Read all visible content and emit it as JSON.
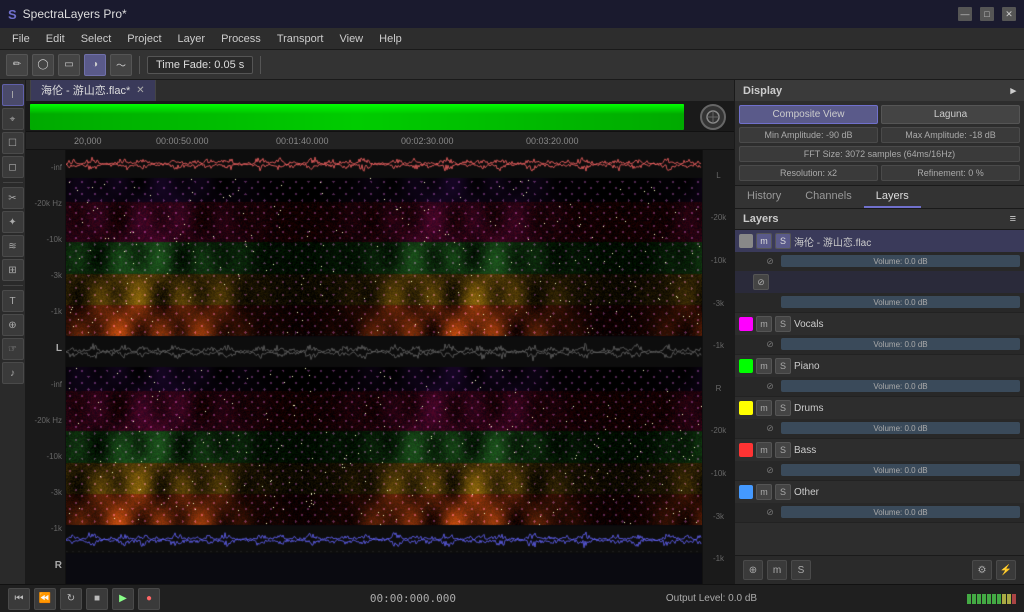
{
  "titlebar": {
    "app_name": "SpectraLayers Pro*",
    "minimize": "—",
    "maximize": "□",
    "close": "✕"
  },
  "menubar": {
    "items": [
      "File",
      "Edit",
      "Select",
      "Project",
      "Layer",
      "Process",
      "Transport",
      "View",
      "Help"
    ]
  },
  "toolbar": {
    "time_fade": "Time Fade: 0.05 s",
    "icons": [
      "pencil",
      "circle-outline",
      "rectangle-outline",
      "toggle-circle",
      "waveform-icon"
    ]
  },
  "tabs": [
    {
      "label": "海伦 - 游山恋.flac*",
      "active": true
    }
  ],
  "timeline": {
    "markers": [
      "20,000",
      "00:00:50.000",
      "00:01:40.000",
      "00:02:30.000",
      "00:03:20.000"
    ]
  },
  "spectral": {
    "freq_labels_top": [
      "-20k Hz",
      "-10k",
      "-3k",
      "-1k"
    ],
    "freq_labels_bottom": [
      "-20k Hz",
      "-10k",
      "-3k",
      "-1k"
    ],
    "db_labels": [
      "-inf",
      "L"
    ],
    "db_right": [
      "-20k",
      "-10k",
      "-3k",
      "-1k"
    ],
    "lr_labels": [
      "L",
      "R"
    ]
  },
  "display_panel": {
    "title": "Display",
    "composite_view_label": "Composite View",
    "laguna_label": "Laguna",
    "min_amplitude_label": "Min Amplitude: -90 dB",
    "max_amplitude_label": "Max Amplitude: -18 dB",
    "fft_label": "FFT Size: 3072 samples (64ms/16Hz)",
    "resolution_label": "Resolution: x2",
    "refinement_label": "Refinement: 0 %"
  },
  "section_tabs": {
    "history": "History",
    "channels": "Channels",
    "layers": "Layers"
  },
  "layers": {
    "title": "Layers",
    "items": [
      {
        "name": "海伦 - 游山恋.flac",
        "color": "#888888",
        "volume": "Volume: 0.0 dB",
        "mute": "m",
        "solo": "S",
        "has_sub": true,
        "sub_volume": "Volume: 0.0 dB"
      },
      {
        "name": "Vocals",
        "color": "#ff00ff",
        "volume": "Volume: 0.0 dB",
        "mute": "m",
        "solo": "S"
      },
      {
        "name": "Piano",
        "color": "#00ff00",
        "volume": "Volume: 0.0 dB",
        "mute": "m",
        "solo": "S"
      },
      {
        "name": "Drums",
        "color": "#ffff00",
        "volume": "Volume: 0.0 dB",
        "mute": "m",
        "solo": "S"
      },
      {
        "name": "Bass",
        "color": "#ff3333",
        "volume": "Volume: 0.0 dB",
        "mute": "m",
        "solo": "S"
      },
      {
        "name": "Other",
        "color": "#4499ff",
        "volume": "Volume: 0.0 dB",
        "mute": "m",
        "solo": "S"
      }
    ]
  },
  "footer": {
    "timecode": "00:00:000.000",
    "output_level": "Output Level: 0.0 dB",
    "transport": {
      "rewind": "⏮",
      "back": "⏪",
      "loop": "↻",
      "stop": "■",
      "play": "▶",
      "record": "●"
    }
  }
}
